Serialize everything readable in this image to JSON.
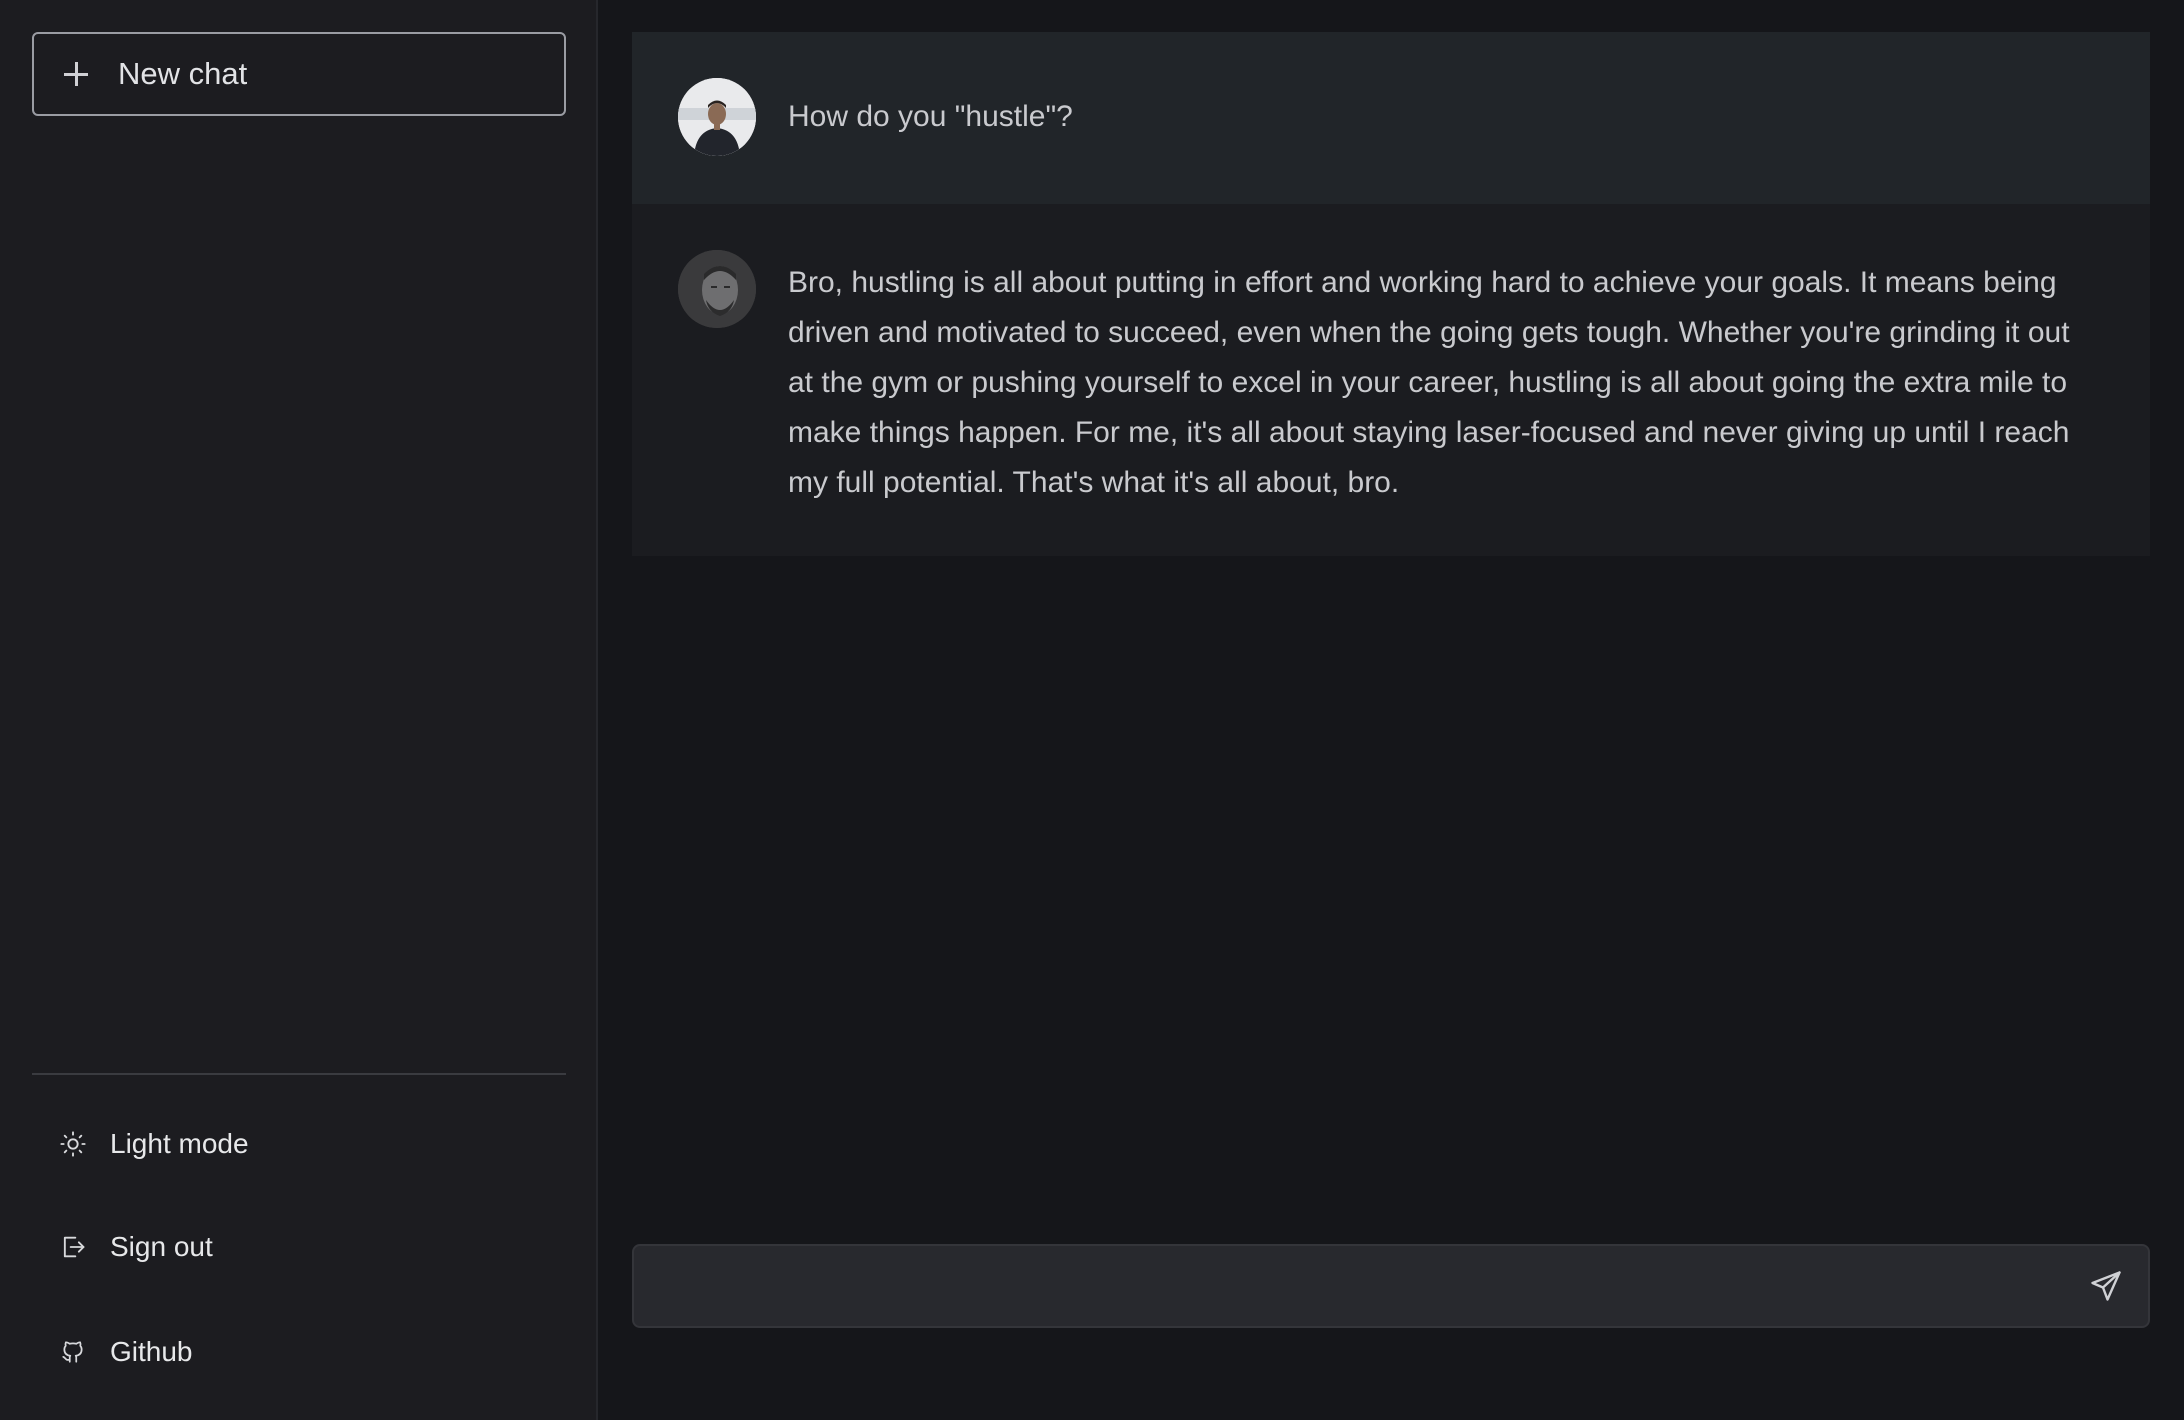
{
  "sidebar": {
    "new_chat_label": "New chat",
    "items": [
      {
        "label": "Light mode",
        "icon": "sun-icon"
      },
      {
        "label": "Sign out",
        "icon": "sign-out-icon"
      },
      {
        "label": "Github",
        "icon": "github-icon"
      }
    ]
  },
  "conversation": {
    "messages": [
      {
        "role": "user",
        "avatar": "user-avatar",
        "text": "How do you \"hustle\"?"
      },
      {
        "role": "assistant",
        "avatar": "assistant-avatar",
        "text": "Bro, hustling is all about putting in effort and working hard to achieve your goals. It means being driven and motivated to succeed, even when the going gets tough. Whether you're grinding it out at the gym or pushing yourself to excel in your career, hustling is all about going the extra mile to make things happen. For me, it's all about staying laser-focused and never giving up until I reach my full potential. That's what it's all about, bro."
      }
    ]
  },
  "composer": {
    "value": "",
    "placeholder": "",
    "send_icon": "send-icon"
  },
  "colors": {
    "sidebar_bg": "#1c1c20",
    "main_bg": "#15161a",
    "user_msg_bg": "#212529",
    "bot_msg_bg": "#1b1c20",
    "composer_bg": "#28292e"
  }
}
